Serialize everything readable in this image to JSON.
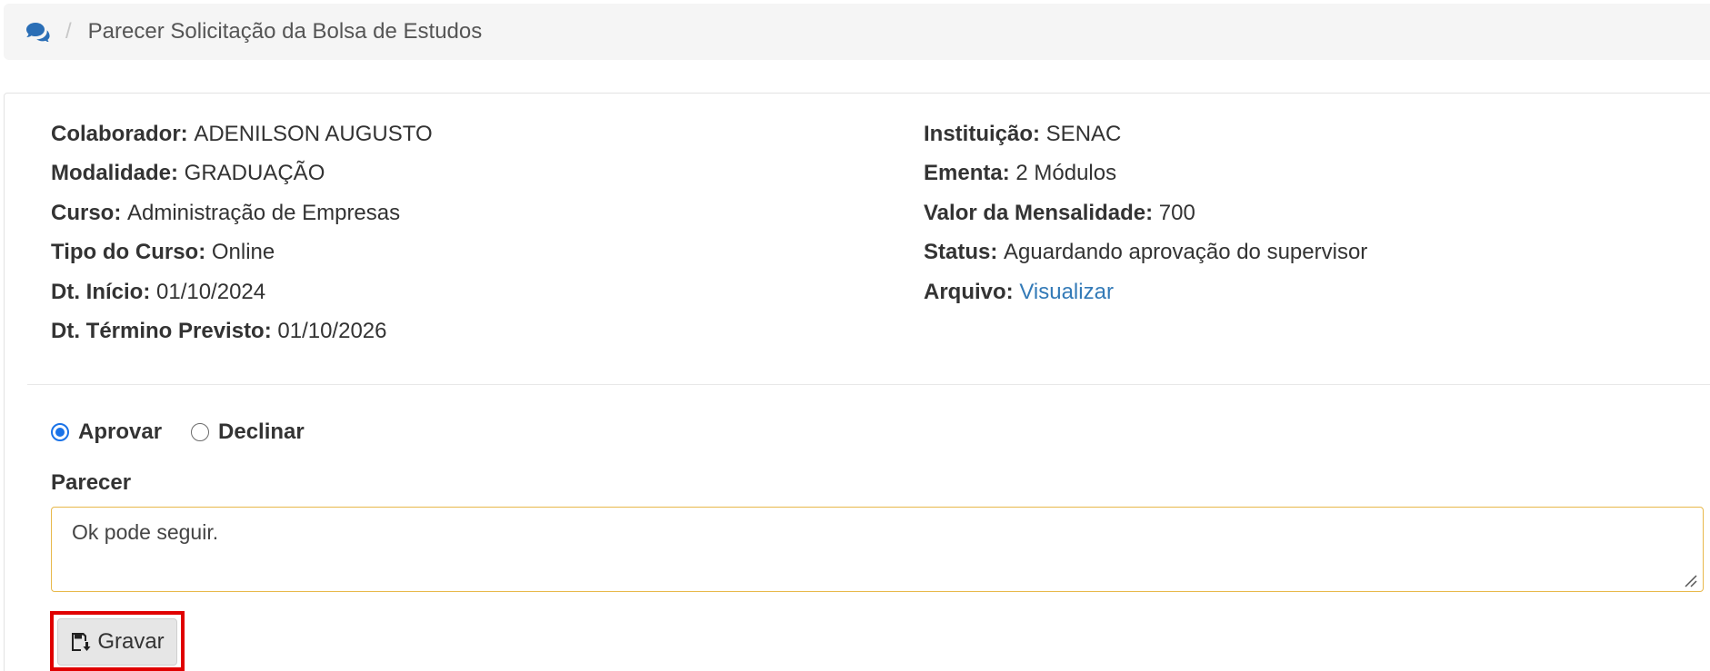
{
  "breadcrumb": {
    "icon": "comments-icon",
    "separator": "/",
    "title": "Parecer Solicitação da Bolsa de Estudos"
  },
  "details": {
    "left": [
      {
        "label": "Colaborador:",
        "value": "ADENILSON AUGUSTO"
      },
      {
        "label": "Modalidade:",
        "value": "GRADUAÇÃO"
      },
      {
        "label": "Curso:",
        "value": "Administração de Empresas"
      },
      {
        "label": "Tipo do Curso:",
        "value": "Online"
      },
      {
        "label": "Dt. Início:",
        "value": "01/10/2024"
      },
      {
        "label": "Dt. Término Previsto:",
        "value": "01/10/2026"
      }
    ],
    "right": [
      {
        "label": "Instituição:",
        "value": "SENAC"
      },
      {
        "label": "Ementa:",
        "value": "2 Módulos"
      },
      {
        "label": "Valor da Mensalidade:",
        "value": "700"
      },
      {
        "label": "Status:",
        "value": "Aguardando aprovação do supervisor"
      },
      {
        "label": "Arquivo:",
        "value": "Visualizar"
      }
    ]
  },
  "decision": {
    "options": [
      {
        "label": "Aprovar",
        "checked": true
      },
      {
        "label": "Declinar",
        "checked": false
      }
    ]
  },
  "parecer": {
    "label": "Parecer",
    "value": "Ok pode seguir."
  },
  "actions": {
    "save_label": "Gravar",
    "save_icon": "save-icon"
  },
  "colors": {
    "link": "#337ab7",
    "radio_accent": "#1a73e8",
    "textarea_border": "#e8b84a",
    "highlight": "#e00000"
  }
}
